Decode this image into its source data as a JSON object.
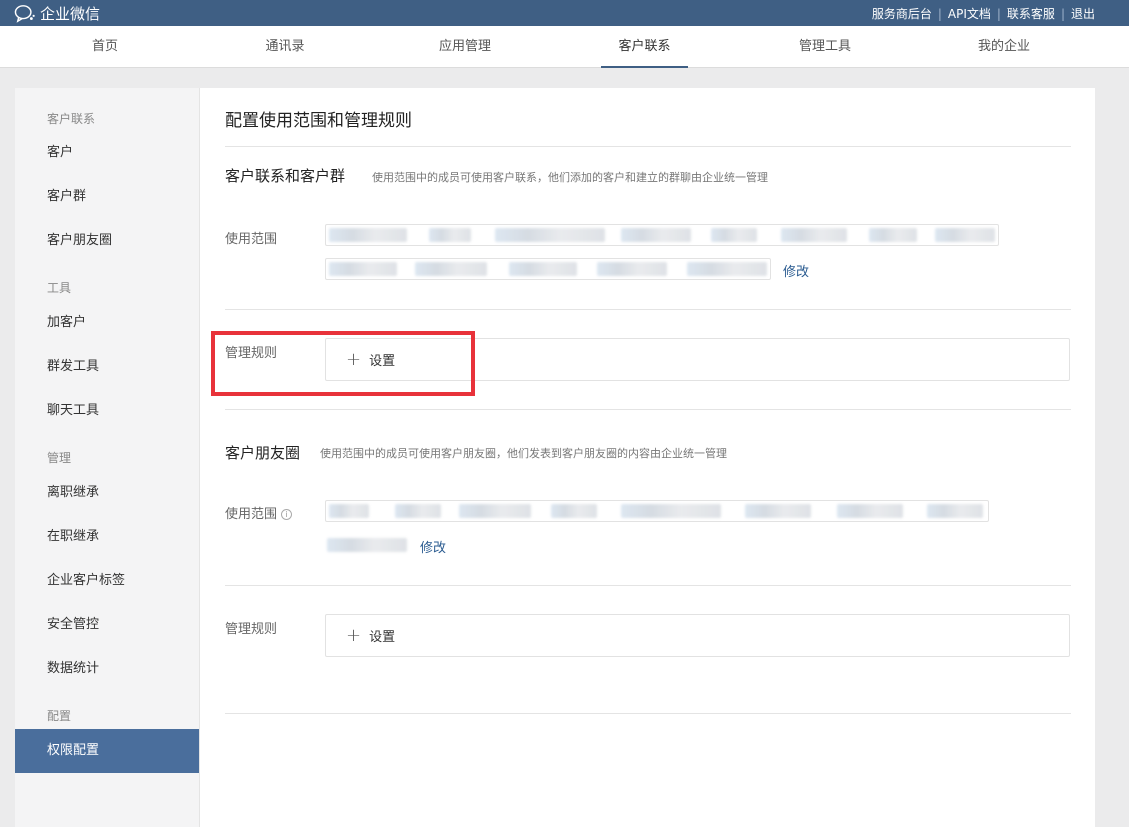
{
  "topbar": {
    "brand": "企业微信",
    "links": [
      "服务商后台",
      "API文档",
      "联系客服",
      "退出"
    ]
  },
  "nav": {
    "items": [
      "首页",
      "通讯录",
      "应用管理",
      "客户联系",
      "管理工具",
      "我的企业"
    ],
    "active": "客户联系"
  },
  "sidebar": {
    "sections": [
      {
        "title": "客户联系",
        "items": [
          "客户",
          "客户群",
          "客户朋友圈"
        ]
      },
      {
        "title": "工具",
        "items": [
          "加客户",
          "群发工具",
          "聊天工具"
        ]
      },
      {
        "title": "管理",
        "items": [
          "离职继承",
          "在职继承",
          "企业客户标签",
          "安全管控",
          "数据统计"
        ]
      },
      {
        "title": "配置",
        "items": [
          "权限配置"
        ]
      }
    ],
    "active": "权限配置"
  },
  "main": {
    "title": "配置使用范围和管理规则",
    "section1": {
      "title": "客户联系和客户群",
      "desc": "使用范围中的成员可使用客户联系，他们添加的客户和建立的群聊由企业统一管理",
      "scope_label": "使用范围",
      "edit": "修改",
      "rule_label": "管理规则",
      "rule_action": "设置"
    },
    "section2": {
      "title": "客户朋友圈",
      "desc": "使用范围中的成员可使用客户朋友圈，他们发表到客户朋友圈的内容由企业统一管理",
      "scope_label": "使用范围",
      "info_icon": "i",
      "edit": "修改",
      "rule_label": "管理规则",
      "rule_action": "设置"
    }
  },
  "colors": {
    "topbar": "#3f5f84",
    "active_sidebar": "#4a6e9c",
    "link": "#2a5b90",
    "highlight": "#e8323a"
  }
}
